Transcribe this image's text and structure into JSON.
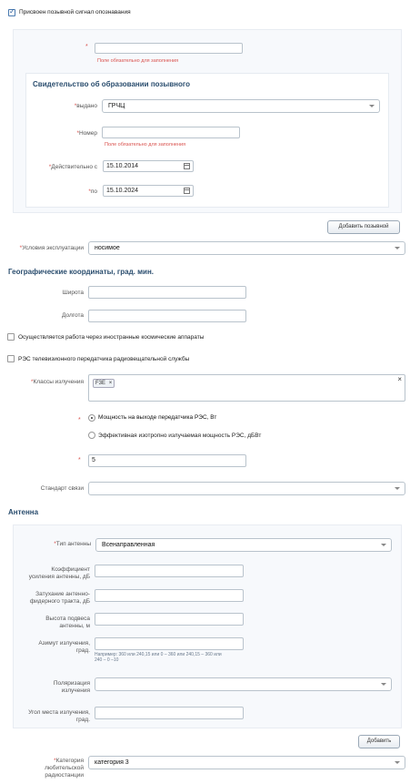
{
  "callsign_checkbox": {
    "label": "Присвоен позывной сигнал опознавания",
    "checked": true
  },
  "callsign_field": {
    "required_mark": "*",
    "value": "",
    "error": "Поле обязательно для заполнения"
  },
  "certificate": {
    "title": "Свидетельство об образовании позывного",
    "issued_label": "выдано",
    "issued_value": "ГРЧЦ",
    "number_label": "Номер",
    "number_value": "",
    "number_error": "Поле обязательно для заполнения",
    "valid_from_label": "Действительно с",
    "valid_from_value": "15.10.2014",
    "valid_to_label": "по",
    "valid_to_value": "15.10.2024",
    "add_button": "Добавить позывной"
  },
  "conditions": {
    "label": "Условия эксплуатации",
    "value": "носимое"
  },
  "geo": {
    "title": "Географические координаты, град. мин.",
    "lat_label": "Широта",
    "lat_value": "",
    "lon_label": "Долгота",
    "lon_value": ""
  },
  "foreign_satellite": {
    "label": "Осуществляется работа через иностранные космические аппараты",
    "checked": false
  },
  "tv_transmitter": {
    "label": "РЭС телевизионного передатчика радиовещательной службы",
    "checked": false
  },
  "emission_classes": {
    "label": "Классы излучения",
    "tags": [
      "F3E"
    ],
    "clear": "×",
    "remove": "×"
  },
  "power": {
    "option1": "Мощность на выходе передатчика РЭС, Вт",
    "option2": "Эффективная изотропно излучаемая мощность РЭС, дБВт",
    "selected": 1,
    "value": "5"
  },
  "standard": {
    "label": "Стандарт связи",
    "value": ""
  },
  "antenna": {
    "title": "Антенна",
    "type_label": "Тип антенны",
    "type_value": "Всенаправленная",
    "gain_label_1": "Коэффициент",
    "gain_label_2": "усиления антенны, дБ",
    "atten_label_1": "Затухание антенно-",
    "atten_label_2": "фидерного тракта, дБ",
    "height_label_1": "Высота подвеса",
    "height_label_2": "антенны, м",
    "azimuth_label_1": "Азимут излучения,",
    "azimuth_label_2": "град.",
    "azimuth_hint_1": "Например: 360 или 240,15 или 0 – 360 или 240,15 – 360 или",
    "azimuth_hint_2": "240 – 0 –10",
    "polar_label_1": "Поляризация",
    "polar_label_2": "излучения",
    "elev_label_1": "Угол места излучения,",
    "elev_label_2": "град.",
    "add_button": "Добавить"
  },
  "category": {
    "label_1": "Категория",
    "label_2": "любительской",
    "label_3": "радиостанции",
    "value": "категория 3"
  },
  "colors": {
    "accent": "#2a4d6e",
    "error": "#d9534f"
  }
}
